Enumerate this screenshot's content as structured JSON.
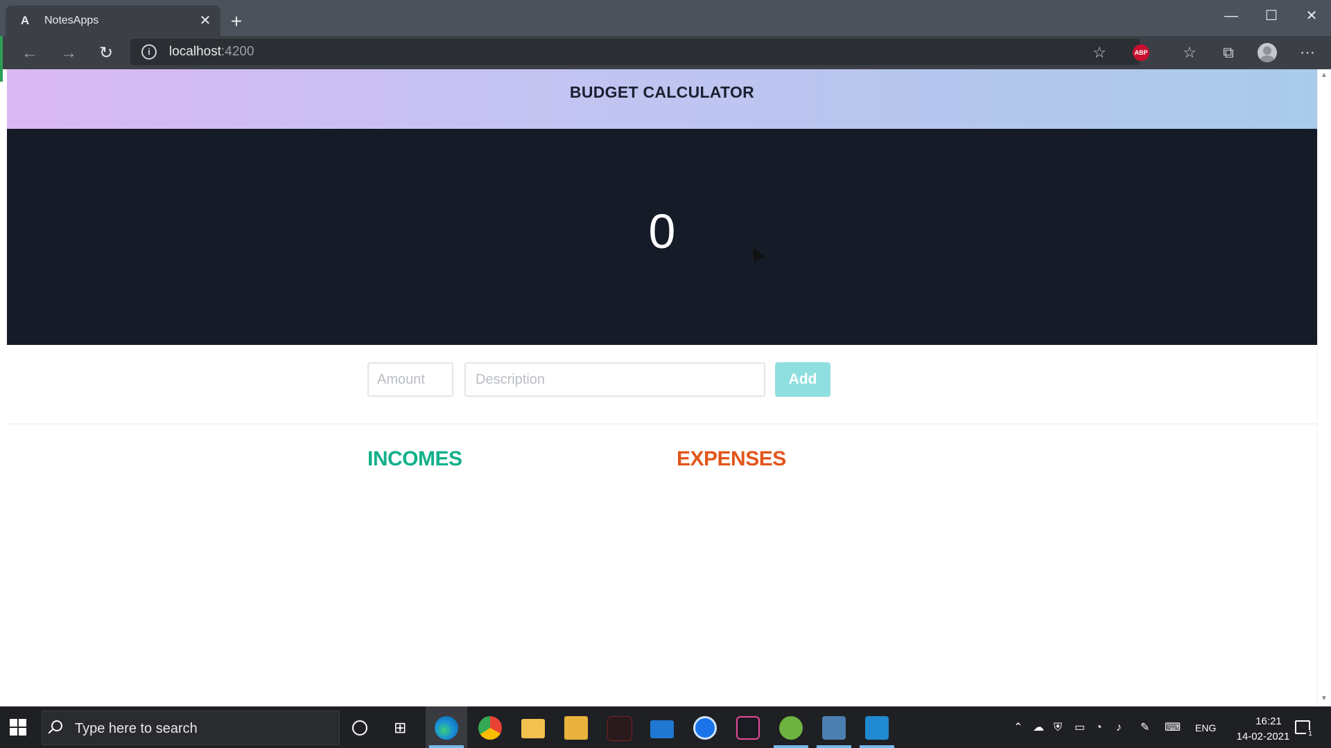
{
  "browser": {
    "tab_title": "NotesApps",
    "tab_close": "✕",
    "new_tab": "+",
    "url_host": "localhost",
    "url_port": ":4200",
    "adblock_label": "ABP",
    "window_controls": {
      "minimize": "—",
      "maximize": "☐",
      "close": "✕"
    },
    "icons": [
      "angular-favicon",
      "back-icon",
      "forward-icon",
      "refresh-icon",
      "info-icon",
      "favorite-add-icon",
      "adblock-icon",
      "favorites-icon",
      "collections-icon",
      "profile-icon",
      "more-icon"
    ]
  },
  "app": {
    "title": "BUDGET CALCULATOR",
    "balance": "0",
    "amount_placeholder": "Amount",
    "description_placeholder": "Description",
    "add_label": "Add",
    "incomes_heading": "INCOMES",
    "expenses_heading": "EXPENSES",
    "colors": {
      "header_start": "#dab8f3",
      "header_end": "#a9cbe9",
      "panel": "#151b27",
      "add_button": "#8fdfe0",
      "incomes": "#12b08a",
      "expenses": "#e2561b"
    }
  },
  "taskbar": {
    "search_placeholder": "Type here to search",
    "apps": [
      "edge-icon",
      "chrome-icon",
      "file-explorer-icon",
      "store-icon",
      "predator-icon",
      "mail-icon",
      "settings-app-icon",
      "terminal-icon",
      "spring-icon",
      "mysql-workbench-icon",
      "vscode-icon"
    ],
    "language": "ENG",
    "time": "16:21",
    "date": "14-02-2021",
    "notification_count": "1"
  }
}
